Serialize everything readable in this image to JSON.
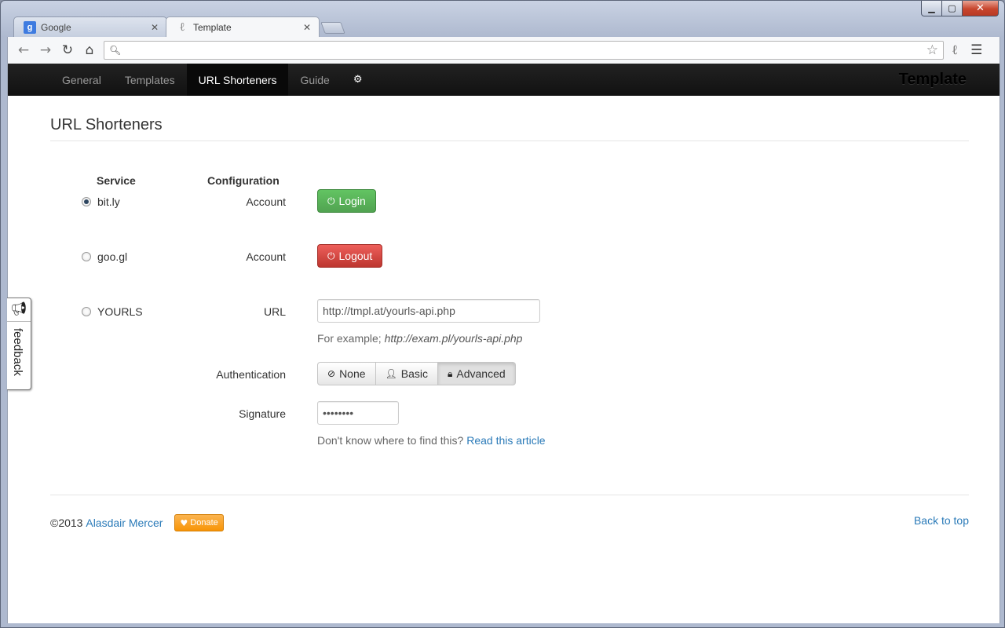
{
  "browser": {
    "tabs": [
      {
        "title": "Google",
        "favicon": "google-icon",
        "active": false
      },
      {
        "title": "Template",
        "favicon": "template-icon",
        "active": true
      }
    ],
    "address": {
      "value": "",
      "placeholder": ""
    }
  },
  "navbar": {
    "items": [
      {
        "label": "General",
        "active": false
      },
      {
        "label": "Templates",
        "active": false
      },
      {
        "label": "URL Shorteners",
        "active": true
      },
      {
        "label": "Guide",
        "active": false
      }
    ],
    "settings_icon": "gear-icon",
    "brand": "Template"
  },
  "page": {
    "title": "URL Shorteners",
    "columns": {
      "service": "Service",
      "configuration": "Configuration"
    },
    "services": [
      {
        "name": "bit.ly",
        "selected": true,
        "field_label": "Account",
        "button": "Login"
      },
      {
        "name": "goo.gl",
        "selected": false,
        "field_label": "Account",
        "button": "Logout"
      },
      {
        "name": "YOURLS",
        "selected": false,
        "field_label": "URL"
      }
    ],
    "yourls": {
      "url_value": "http://tmpl.at/yourls-api.php",
      "example_prefix": "For example;",
      "example_url": "http://exam.pl/yourls-api.php",
      "auth_label": "Authentication",
      "auth_options": [
        "None",
        "Basic",
        "Advanced"
      ],
      "auth_selected": "Advanced",
      "signature_label": "Signature",
      "signature_value": "password",
      "help_text": "Don't know where to find this?",
      "help_link": "Read this article"
    }
  },
  "footer": {
    "copyright": "©2013",
    "author": "Alasdair Mercer",
    "donate": "Donate",
    "back_to_top": "Back to top"
  },
  "feedback": {
    "label": "feedback"
  },
  "colors": {
    "navbar_bg": "#1b1b1b",
    "login_green": "#5bb75b",
    "logout_red": "#da4f49",
    "link_blue": "#2a7ab8",
    "donate_orange": "#faa732"
  }
}
